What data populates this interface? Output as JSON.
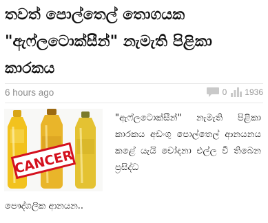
{
  "article": {
    "headline": "තවත් පොල්තෙල් තොගයක \"ඇෆ්ලටොක්සීන්\" නැමැති පිළිකා කාරකය",
    "time": "6 hours ago",
    "comments": "0",
    "views": "1936",
    "excerpt": "\"ඇෆ්ලටොක්සීන්\" නැමැති පිළිකා කාරකය අඩංගු පොල්තෙල් ආනයනය කළේ යැයි චෝදනා එල්ල වී තිබෙන ප්‍රසිද්ධ",
    "excerpt_tail": "පෞද්ගලික ආනයන..",
    "image_label": "CANCER"
  },
  "icons": {
    "comments": "comment-icon",
    "views": "bar-chart-icon"
  }
}
